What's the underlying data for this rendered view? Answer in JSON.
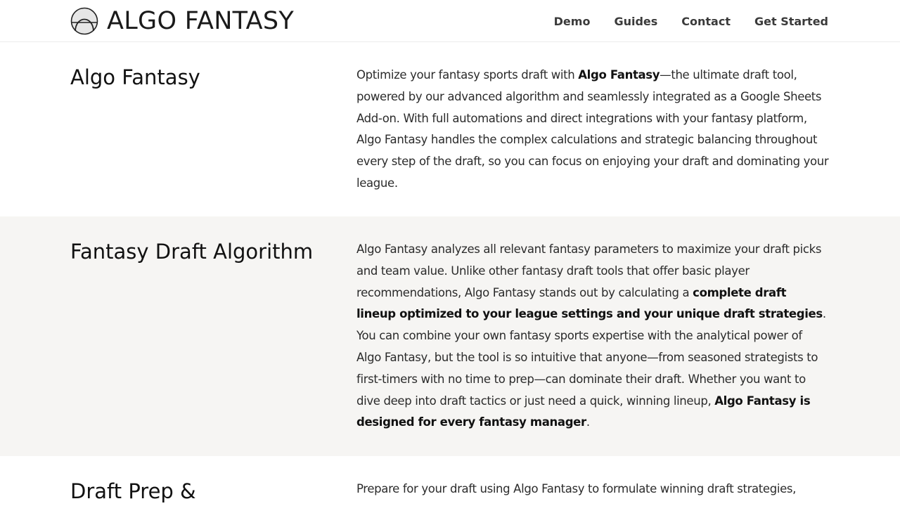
{
  "header": {
    "brand": "ALGO FANTASY",
    "logo_icon": "arch-logo-icon",
    "nav": [
      "Demo",
      "Guides",
      "Contact",
      "Get Started"
    ]
  },
  "sections": [
    {
      "title": "Algo Fantasy",
      "paragraph": [
        {
          "text": "Optimize your fantasy sports draft with ",
          "bold": false
        },
        {
          "text": "Algo Fantasy",
          "bold": true
        },
        {
          "text": "—the ultimate draft tool, powered by our advanced algorithm and seamlessly integrated as a Google Sheets Add-on. With full automations and direct integrations with your fantasy platform, Algo Fantasy handles the complex calculations and strategic balancing throughout every step of the draft, so you can focus on enjoying your draft and dominating your league.",
          "bold": false
        }
      ]
    },
    {
      "title": "Fantasy Draft Algorithm",
      "paragraph": [
        {
          "text": "Algo Fantasy analyzes all relevant fantasy parameters to maximize your draft picks and team value. Unlike other fantasy draft tools that offer basic player recommendations, Algo Fantasy stands out by calculating a ",
          "bold": false
        },
        {
          "text": "complete draft lineup optimized to your league settings and your unique draft strategies",
          "bold": true
        },
        {
          "text": ". You can combine your own fantasy sports expertise with the analytical power of Algo Fantasy, but the tool is so intuitive that anyone—from seasoned strategists to first-timers with no time to prep—can dominate their draft. Whether you want to dive deep into draft tactics or just need a quick, winning lineup, ",
          "bold": false
        },
        {
          "text": "Algo Fantasy is designed for every fantasy manager",
          "bold": true
        },
        {
          "text": ".",
          "bold": false
        }
      ]
    },
    {
      "title": "Draft Prep &",
      "paragraph": [
        {
          "text": "Prepare for your draft using Algo Fantasy to formulate winning draft strategies,",
          "bold": false
        }
      ]
    }
  ],
  "colors": {
    "alt_section_bg": "#f6f5f3",
    "text": "#2b2b2b",
    "heading": "#111111"
  }
}
